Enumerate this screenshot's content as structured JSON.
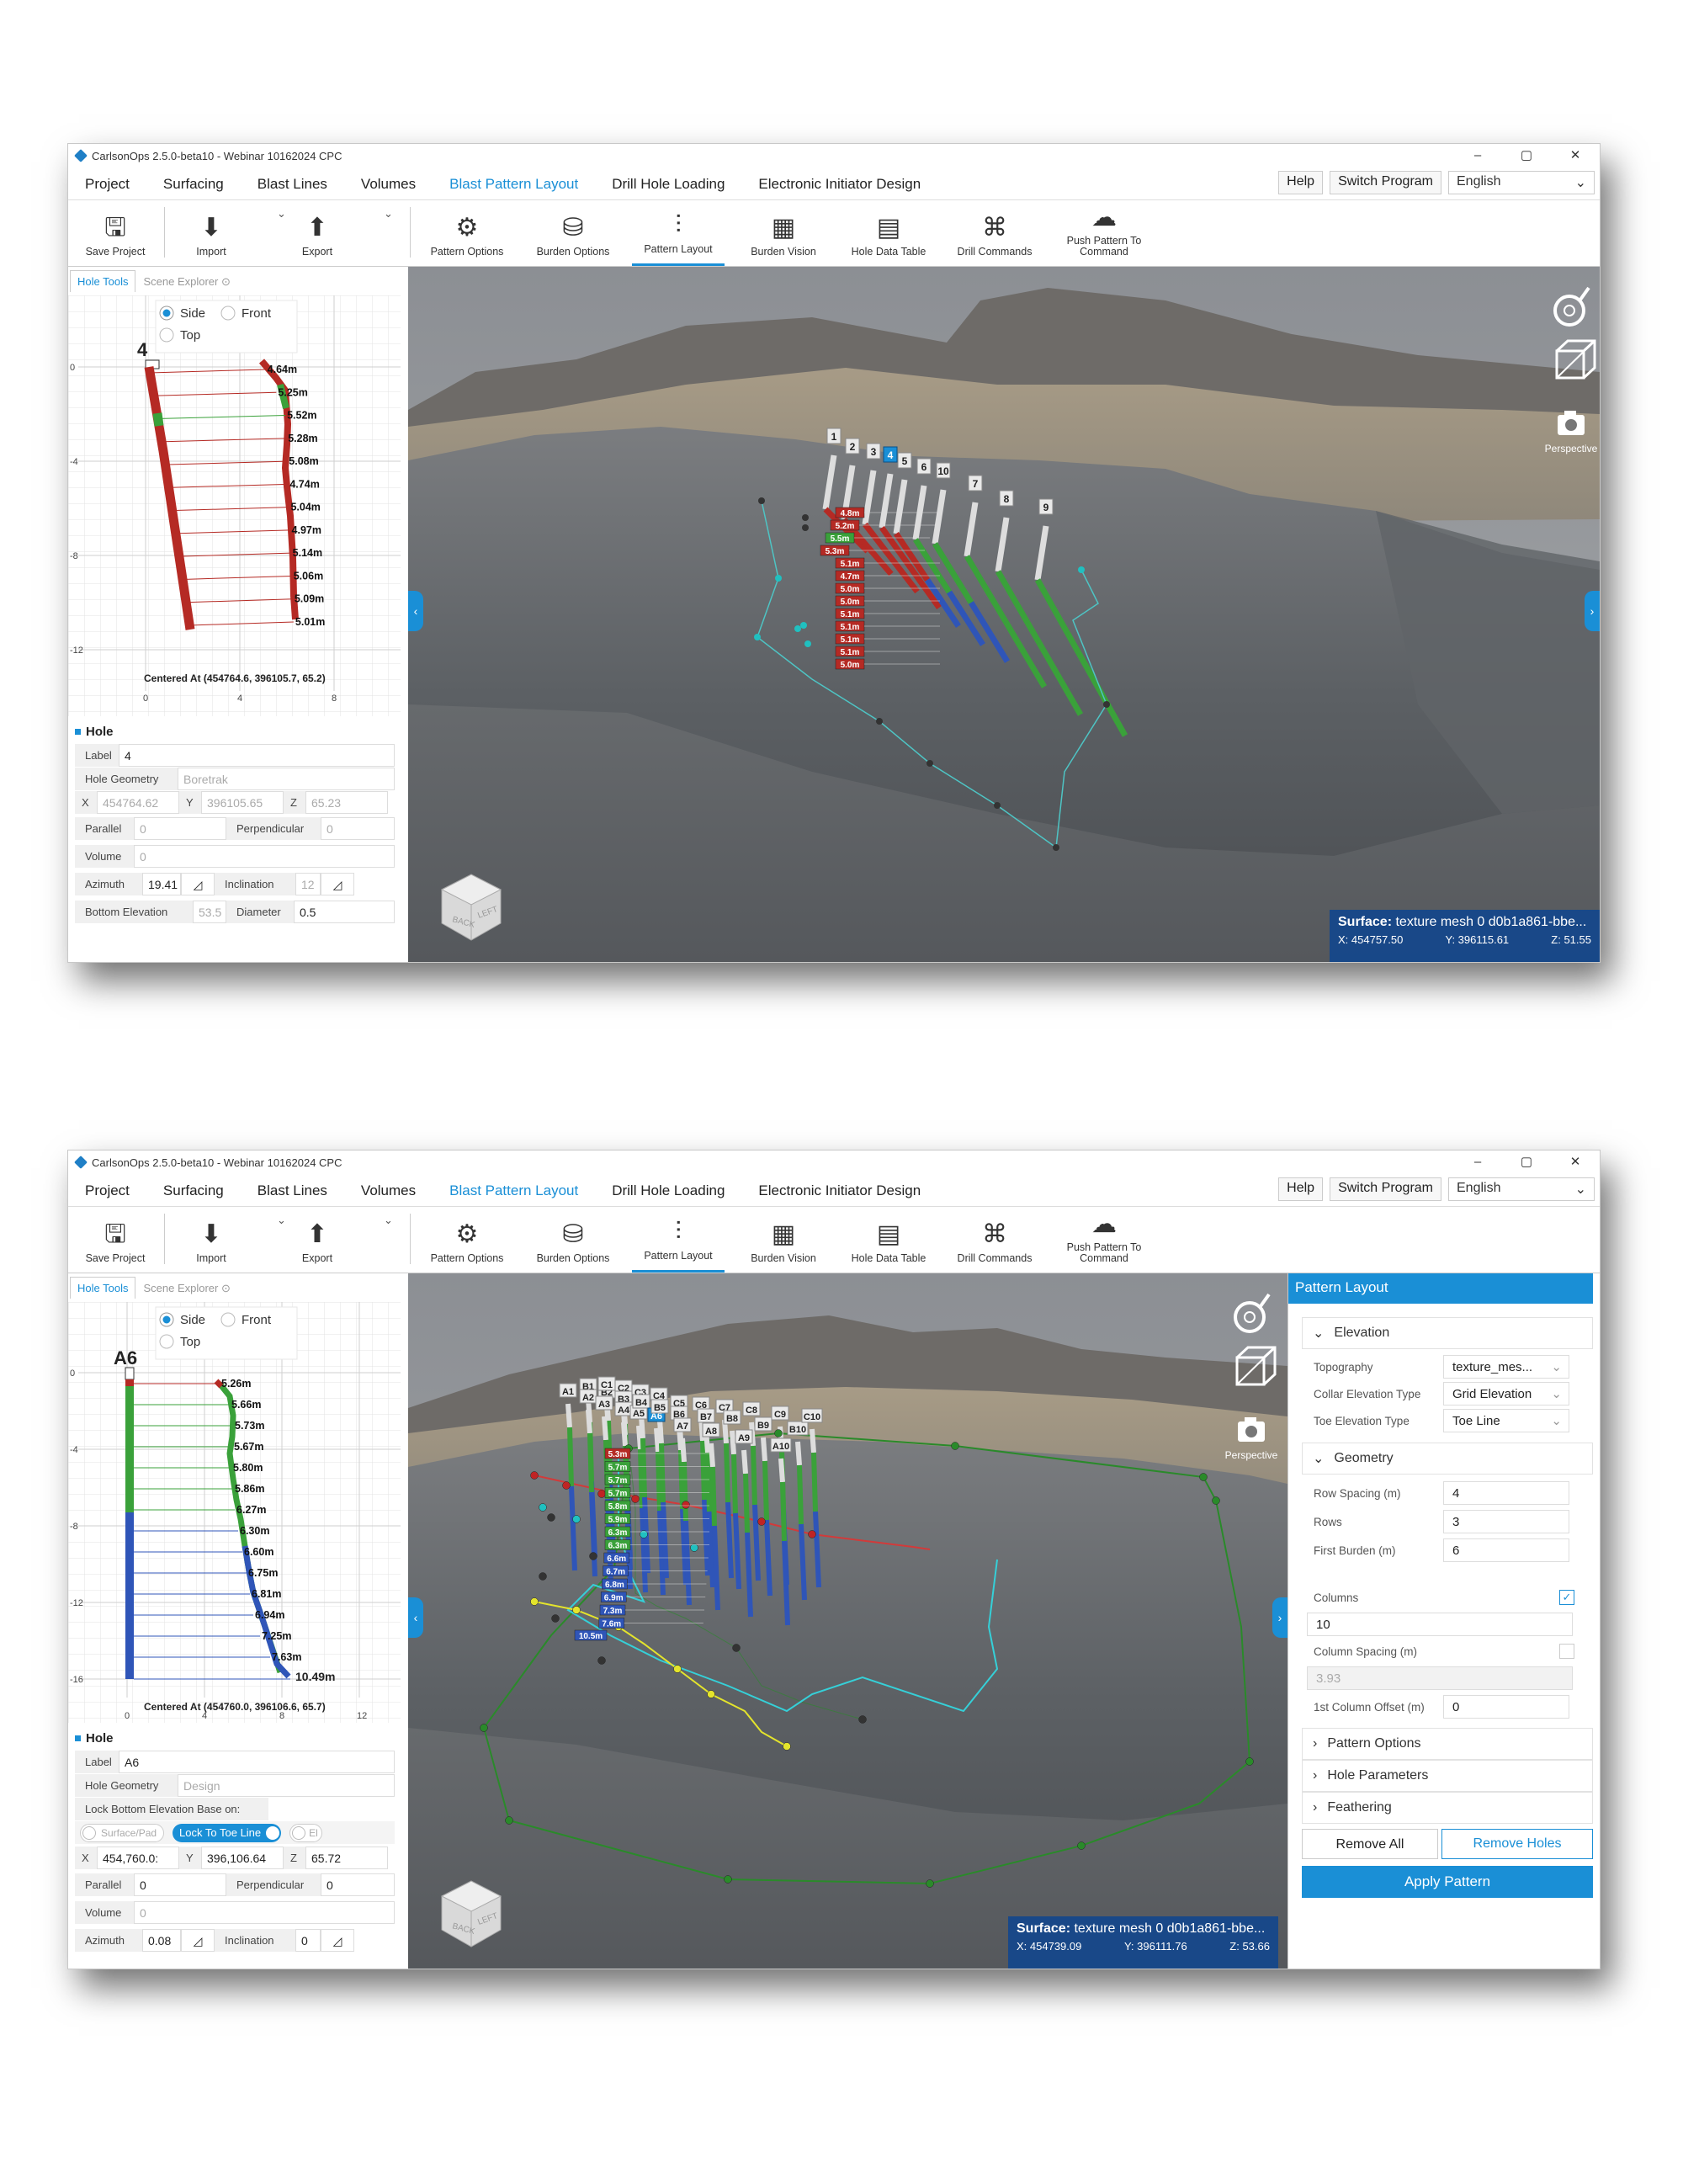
{
  "app": {
    "title": "CarlsonOps 2.5.0-beta10 - Webinar 10162024 CPC",
    "window_controls": [
      "–",
      "▢",
      "✕"
    ]
  },
  "menu": [
    "Project",
    "Surfacing",
    "Blast Lines",
    "Volumes",
    "Blast Pattern Layout",
    "Drill Hole Loading",
    "Electronic Initiator Design"
  ],
  "menu_active": "Blast Pattern Layout",
  "menu_right": {
    "help": "Help",
    "switch": "Switch Program",
    "language": "English"
  },
  "ribbon": {
    "save": "Save Project",
    "import": "Import",
    "export": "Export",
    "pattern_options": "Pattern Options",
    "burden_options": "Burden Options",
    "pattern_layout": "Pattern Layout",
    "burden_vision": "Burden Vision",
    "hole_data_table": "Hole Data Table",
    "drill_commands": "Drill Commands",
    "push_pattern": "Push Pattern To Command"
  },
  "panel_tabs": {
    "hole_tools": "Hole Tools",
    "scene_explorer": "Scene Explorer"
  },
  "view_radio": {
    "side": "Side",
    "front": "Front",
    "top": "Top",
    "selected": "Side"
  },
  "viewport": {
    "perspective": "Perspective",
    "cube_back": "BACK",
    "cube_left": "LEFT"
  },
  "screen1": {
    "graph": {
      "hole_label": "4",
      "centered": "Centered At (454764.6, 396105.7, 65.2)",
      "y_ticks": [
        "0",
        "-4",
        "-8",
        "-12"
      ],
      "x_ticks": [
        "0",
        "4",
        "8"
      ],
      "burdens": [
        "4.64m",
        "5.25m",
        "5.52m",
        "5.28m",
        "5.08m",
        "4.74m",
        "5.04m",
        "4.97m",
        "5.14m",
        "5.06m",
        "5.09m",
        "5.01m"
      ]
    },
    "hole": {
      "section": "Hole",
      "label_l": "Label",
      "label_v": "4",
      "geom_l": "Hole Geometry",
      "geom_v": "Boretrak",
      "x_l": "X",
      "x_v": "454764.62",
      "y_l": "Y",
      "y_v": "396105.65",
      "z_l": "Z",
      "z_v": "65.23",
      "parallel_l": "Parallel",
      "parallel_v": "0",
      "perp_l": "Perpendicular",
      "perp_v": "0",
      "volume_l": "Volume",
      "volume_v": "0",
      "azimuth_l": "Azimuth",
      "azimuth_v": "19.41",
      "incl_l": "Inclination",
      "incl_v": "12",
      "bottom_l": "Bottom Elevation",
      "bottom_v": "53.5",
      "diam_l": "Diameter",
      "diam_v": "0.5"
    },
    "scene": {
      "hole_labels": [
        "1",
        "2",
        "3",
        "4",
        "5",
        "6",
        "10",
        "7",
        "8",
        "9"
      ],
      "selected_hole": "4",
      "burden_tags": [
        "4.8m",
        "5.2m",
        "5.5m",
        "5.3m",
        "5.1m",
        "4.7m",
        "5.0m",
        "5.0m",
        "5.1m",
        "5.1m",
        "5.1m",
        "5.1m",
        "5.0m"
      ]
    },
    "status": {
      "surface": "Surface:",
      "surface_v": "texture mesh 0 d0b1a861-bbe...",
      "x": "X: 454757.50",
      "y": "Y: 396115.61",
      "z": "Z: 51.55"
    }
  },
  "screen2": {
    "graph": {
      "hole_label": "A6",
      "centered": "Centered At (454760.0, 396106.6, 65.7)",
      "y_ticks": [
        "0",
        "-4",
        "-8",
        "-12",
        "-16"
      ],
      "x_ticks": [
        "0",
        "4",
        "8",
        "12"
      ],
      "burdens": [
        "5.26m",
        "5.66m",
        "5.73m",
        "5.67m",
        "5.80m",
        "5.86m",
        "6.27m",
        "6.30m",
        "6.60m",
        "6.75m",
        "6.81m",
        "6.94m",
        "7.25m",
        "7.63m"
      ],
      "toe_burden": "10.49m"
    },
    "hole": {
      "section": "Hole",
      "label_l": "Label",
      "label_v": "A6",
      "geom_l": "Hole Geometry",
      "geom_v": "Design",
      "lock_l": "Lock Bottom Elevation Base on:",
      "lock_opt1": "Surface/Pad",
      "lock_opt2": "Lock To Toe Line",
      "lock_opt3": "El",
      "x_l": "X",
      "x_v": "454,760.0:",
      "y_l": "Y",
      "y_v": "396,106.64",
      "z_l": "Z",
      "z_v": "65.72",
      "parallel_l": "Parallel",
      "parallel_v": "0",
      "perp_l": "Perpendicular",
      "perp_v": "0",
      "volume_l": "Volume",
      "volume_v": "0",
      "azimuth_l": "Azimuth",
      "azimuth_v": "0.08",
      "incl_l": "Inclination",
      "incl_v": "0"
    },
    "scene": {
      "hole_labels": [
        "A1",
        "B1",
        "A2",
        "B2",
        "C1",
        "C2",
        "A3",
        "B3",
        "A4",
        "C3",
        "C4",
        "A5",
        "B4",
        "A6",
        "B5",
        "C5",
        "B6",
        "C6",
        "A7",
        "B7",
        "C7",
        "A8",
        "B8",
        "C8",
        "A9",
        "B9",
        "C9",
        "A10",
        "B10",
        "C10"
      ],
      "selected_hole": "A6",
      "burden_tags": [
        "5.3m",
        "5.7m",
        "5.7m",
        "5.7m",
        "5.8m",
        "5.9m",
        "6.3m",
        "6.3m",
        "6.6m",
        "6.7m",
        "6.8m",
        "6.9m",
        "7.3m",
        "7.6m",
        "10.5m"
      ]
    },
    "status": {
      "surface": "Surface:",
      "surface_v": "texture mesh 0 d0b1a861-bbe...",
      "x": "X: 454739.09",
      "y": "Y: 396111.76",
      "z": "Z: 53.66"
    },
    "pattern_layout": {
      "title": "Pattern Layout",
      "elevation": "Elevation",
      "topography_l": "Topography",
      "topography_v": "texture_mes...",
      "collar_l": "Collar Elevation Type",
      "collar_v": "Grid Elevation",
      "toe_l": "Toe Elevation Type",
      "toe_v": "Toe Line",
      "geometry": "Geometry",
      "row_spacing_l": "Row Spacing (m)",
      "row_spacing_v": "4",
      "rows_l": "Rows",
      "rows_v": "3",
      "first_burden_l": "First Burden (m)",
      "first_burden_v": "6",
      "columns_l": "Columns",
      "columns_v": "10",
      "col_spacing_l": "Column Spacing (m)",
      "col_spacing_v": "3.93",
      "col_offset_l": "1st Column Offset (m)",
      "col_offset_v": "0",
      "pattern_options": "Pattern Options",
      "hole_parameters": "Hole Parameters",
      "feathering": "Feathering",
      "remove_all": "Remove All",
      "remove_holes": "Remove Holes",
      "apply": "Apply Pattern"
    }
  },
  "colors": {
    "accent": "#1a8fd6",
    "hole_red": "#b52a24",
    "hole_green": "#3aa13a",
    "hole_blue": "#2f55b8",
    "status_bg": "#14468c"
  }
}
